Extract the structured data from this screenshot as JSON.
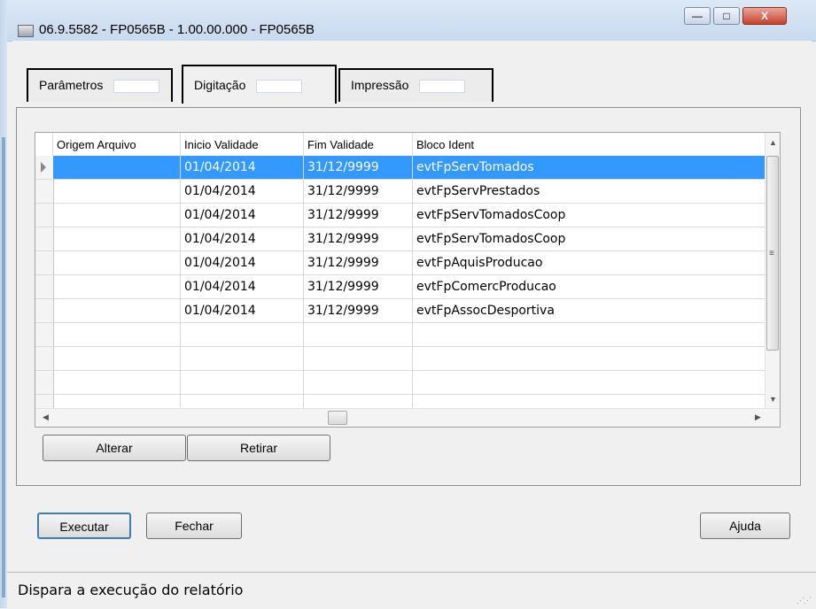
{
  "window": {
    "title": "06.9.5582 - FP0565B - 1.00.00.000 - FP0565B",
    "minimize_glyph": "—",
    "maximize_glyph": "□",
    "close_glyph": "X"
  },
  "tabs": [
    {
      "label": "Parâmetros"
    },
    {
      "label": "Digitação"
    },
    {
      "label": "Impressão"
    }
  ],
  "active_tab": "Digitação",
  "grid": {
    "columns": [
      "Origem Arquivo",
      "Inicio Validade",
      "Fim Validade",
      "Bloco Ident"
    ],
    "rows": [
      {
        "origem": "",
        "inicio": "01/04/2014",
        "fim": "31/12/9999",
        "bloco": "evtFpServTomados"
      },
      {
        "origem": "",
        "inicio": "01/04/2014",
        "fim": "31/12/9999",
        "bloco": "evtFpServPrestados"
      },
      {
        "origem": "",
        "inicio": "01/04/2014",
        "fim": "31/12/9999",
        "bloco": "evtFpServTomadosCoop"
      },
      {
        "origem": "",
        "inicio": "01/04/2014",
        "fim": "31/12/9999",
        "bloco": "evtFpServTomadosCoop"
      },
      {
        "origem": "",
        "inicio": "01/04/2014",
        "fim": "31/12/9999",
        "bloco": "evtFpAquisProducao"
      },
      {
        "origem": "",
        "inicio": "01/04/2014",
        "fim": "31/12/9999",
        "bloco": "evtFpComercProducao"
      },
      {
        "origem": "",
        "inicio": "01/04/2014",
        "fim": "31/12/9999",
        "bloco": "evtFpAssocDesportiva"
      }
    ],
    "selected_row": 0
  },
  "buttons": {
    "alterar": "Alterar",
    "retirar": "Retirar",
    "executar": "Executar",
    "fechar": "Fechar",
    "ajuda": "Ajuda"
  },
  "status": {
    "text": "Dispara a execução do relatório"
  },
  "colors": {
    "selection": "#3399ff",
    "close_button": "#c7412c",
    "titlebar": "#c8daee"
  },
  "icons": {
    "window_icon": "app-window-icon",
    "row_pointer": "row-pointer-icon",
    "scroll_up": "scroll-up-icon",
    "scroll_down": "scroll-down-icon",
    "scroll_left": "scroll-left-icon",
    "scroll_right": "scroll-right-icon",
    "size_grip": "size-grip-icon"
  }
}
